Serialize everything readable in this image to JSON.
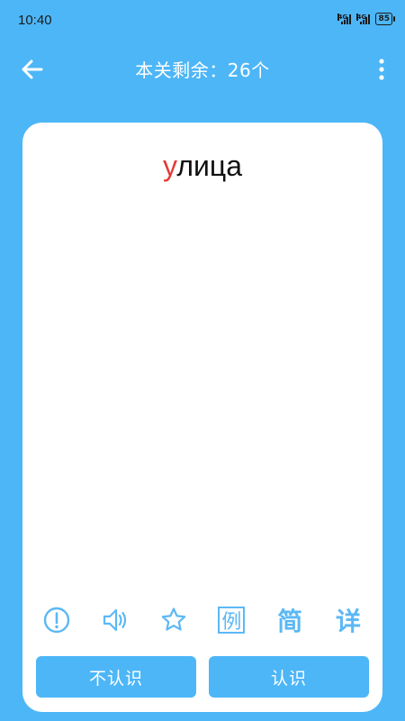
{
  "status_bar": {
    "time": "10:40",
    "signal1_label": "4G",
    "signal2_label": "4G",
    "battery": "85"
  },
  "app_bar": {
    "title": "本关剩余：26个",
    "back_icon": "arrow-left-icon",
    "more_icon": "more-vertical-icon"
  },
  "card": {
    "word_first": "у",
    "word_rest": "лица"
  },
  "tools": {
    "info_icon": "exclamation-circle-icon",
    "sound_icon": "speaker-icon",
    "star_icon": "star-icon",
    "example_label": "例",
    "simple_label": "简",
    "detail_label": "详"
  },
  "actions": {
    "unknown_label": "不认识",
    "known_label": "认识"
  },
  "colors": {
    "accent": "#4db6f7",
    "icon": "#5cb8f5",
    "highlight": "#e53935"
  }
}
